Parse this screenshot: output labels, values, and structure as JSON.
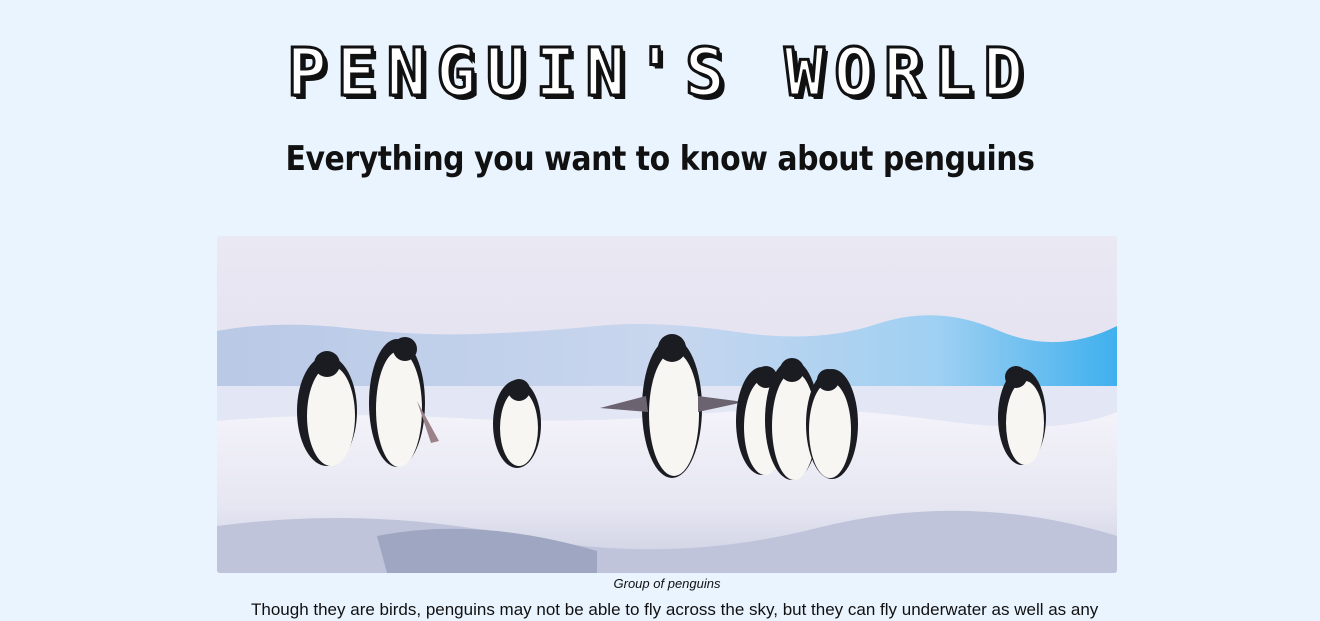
{
  "header": {
    "title": "PENGUIN'S WORLD",
    "subtitle": "Everything you want to know about penguins"
  },
  "hero": {
    "image_alt": "Group of penguins on ice",
    "caption": "Group of penguins"
  },
  "content": {
    "intro": "Though they are birds, penguins may not be able to fly across the sky, but they can fly underwater as well as any"
  },
  "colors": {
    "background": "#e9f4ff",
    "title_fill": "#ffffff",
    "title_outline": "#111111"
  }
}
